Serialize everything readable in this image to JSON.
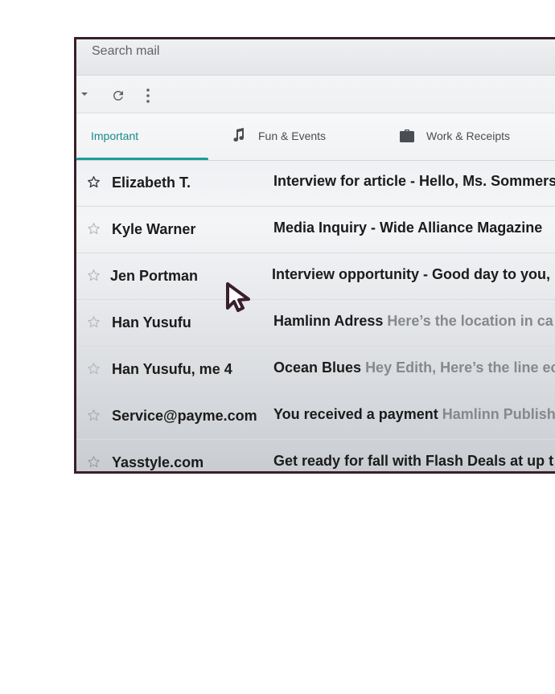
{
  "search": {
    "placeholder": "Search mail"
  },
  "tabs": [
    {
      "label": "Important",
      "icon": "none",
      "active": true
    },
    {
      "label": "Fun & Events",
      "icon": "music-note-icon",
      "active": false
    },
    {
      "label": "Work & Receipts",
      "icon": "briefcase-icon",
      "active": false
    }
  ],
  "emails": [
    {
      "sender": "Elizabeth T.",
      "subject": "Interview for article - Hello, Ms. Sommers",
      "snippet": "",
      "starred_style": "dark"
    },
    {
      "sender": "Kyle Warner",
      "subject": "Media Inquiry - Wide Alliance Magazine",
      "snippet": "",
      "starred_style": "light"
    },
    {
      "sender": "Jen Portman",
      "subject": "Interview opportunity - Good day to you,",
      "snippet": "",
      "starred_style": "light"
    },
    {
      "sender": "Han Yusufu",
      "subject": "Hamlinn Adress",
      "snippet": "Here’s the location in ca",
      "starred_style": "light"
    },
    {
      "sender": "Han Yusufu, me 4",
      "subject": "Ocean Blues",
      "snippet": "Hey Edith, Here’s the line ec",
      "starred_style": "light"
    },
    {
      "sender": "Service@payme.com",
      "subject": "You received a payment",
      "snippet": "Hamlinn Publish",
      "starred_style": "light"
    },
    {
      "sender": "Yasstyle.com",
      "subject": "Get ready for fall with Flash Deals at up t",
      "snippet": "",
      "starred_style": "light"
    }
  ],
  "colors": {
    "accent": "#1a9e99",
    "frame_border": "#3a1f2b",
    "cursor": "#3a1f2b"
  }
}
